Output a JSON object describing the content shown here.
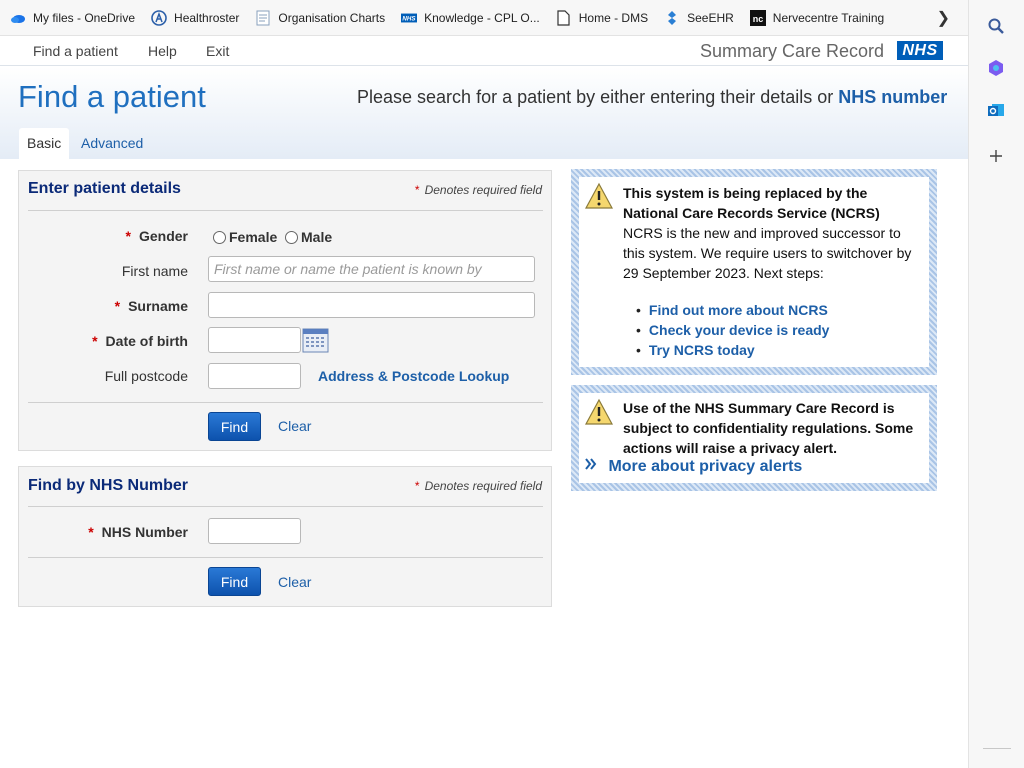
{
  "bookmarks": [
    {
      "label": "My files - OneDrive",
      "icon": "onedrive-cloud-icon"
    },
    {
      "label": "Healthroster",
      "icon": "healthroster-icon"
    },
    {
      "label": "Organisation Charts",
      "icon": "document-icon"
    },
    {
      "label": "Knowledge - CPL O...",
      "icon": "nhs-icon"
    },
    {
      "label": "Home - DMS",
      "icon": "page-icon"
    },
    {
      "label": "SeeEHR",
      "icon": "seeehr-icon"
    },
    {
      "label": "Nervecentre Training",
      "icon": "nc-icon"
    }
  ],
  "nav": {
    "find_patient": "Find a patient",
    "help": "Help",
    "exit": "Exit",
    "scr_title": "Summary Care Record",
    "nhs_logo": "NHS"
  },
  "header": {
    "title": "Find a patient",
    "intro_text": "Please search for a patient by either entering their details or",
    "intro_link": "NHS number",
    "tabs": {
      "basic": "Basic",
      "advanced": "Advanced"
    }
  },
  "patient_form": {
    "title": "Enter patient details",
    "required_note": "Denotes required field",
    "gender_label": "Gender",
    "female": "Female",
    "male": "Male",
    "first_name_label": "First name",
    "first_name_placeholder": "First name or name the patient is known by",
    "surname_label": "Surname",
    "dob_label": "Date of birth",
    "postcode_label": "Full postcode",
    "lookup_link": "Address & Postcode Lookup",
    "find_button": "Find",
    "clear_link": "Clear"
  },
  "nhs_form": {
    "title": "Find by NHS Number",
    "required_note": "Denotes required field",
    "nhs_label": "NHS Number",
    "find_button": "Find",
    "clear_link": "Clear"
  },
  "ncrs_notice": {
    "line1": "This system is being replaced by the",
    "line2": "National Care Records Service (NCRS)",
    "line3": "NCRS is the new and improved successor to",
    "line4": "this system. We require users to switchover by",
    "line5": "29 September 2023. Next steps:",
    "links": [
      "Find out more about NCRS",
      "Check your device is ready",
      "Try NCRS today"
    ]
  },
  "privacy_notice": {
    "line1": "Use of the NHS Summary Care Record is",
    "line2": "subject to confidentiality regulations. Some",
    "line3": "actions will raise a privacy alert.",
    "link": "More about privacy alerts"
  },
  "colors": {
    "accent": "#1d5fa8",
    "heading": "#0b2a78",
    "nhs_blue": "#005eb8",
    "required": "#cc0000"
  }
}
